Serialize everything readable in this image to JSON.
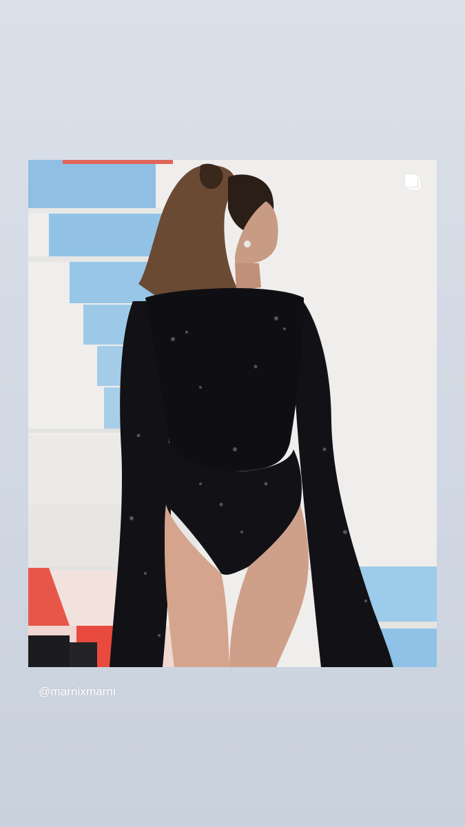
{
  "story": {
    "mention": "@marnixmarni"
  },
  "post": {
    "image_description_icon": "multiple-photos-icon"
  },
  "colors": {
    "background_top": "#dbe1ea",
    "background_bottom": "#c9d1dd",
    "mention_text": "#ffffff"
  }
}
